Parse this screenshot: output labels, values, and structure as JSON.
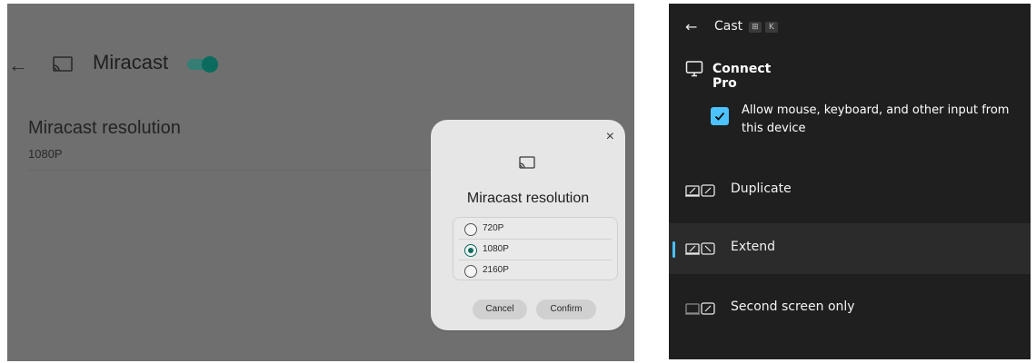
{
  "left_panel": {
    "header": {
      "title": "Miracast",
      "toggle_on": true
    },
    "setting": {
      "title": "Miracast resolution",
      "value": "1080P"
    },
    "dialog": {
      "title": "Miracast resolution",
      "options": [
        {
          "label": "720P",
          "selected": false
        },
        {
          "label": "1080P",
          "selected": true
        },
        {
          "label": "2160P",
          "selected": false
        }
      ],
      "cancel_label": "Cancel",
      "confirm_label": "Confirm",
      "close_glyph": "×"
    }
  },
  "right_panel": {
    "header": {
      "title": "Cast",
      "keys": [
        "⊞",
        "K"
      ]
    },
    "device": {
      "name": "Connect Pro"
    },
    "checkbox": {
      "label": "Allow mouse, keyboard, and other input from this device",
      "checked": true
    },
    "modes": [
      {
        "label": "Duplicate",
        "active": false
      },
      {
        "label": "Extend",
        "active": true
      },
      {
        "label": "Second screen only",
        "active": false
      }
    ],
    "accent_color": "#4cc2ff"
  }
}
